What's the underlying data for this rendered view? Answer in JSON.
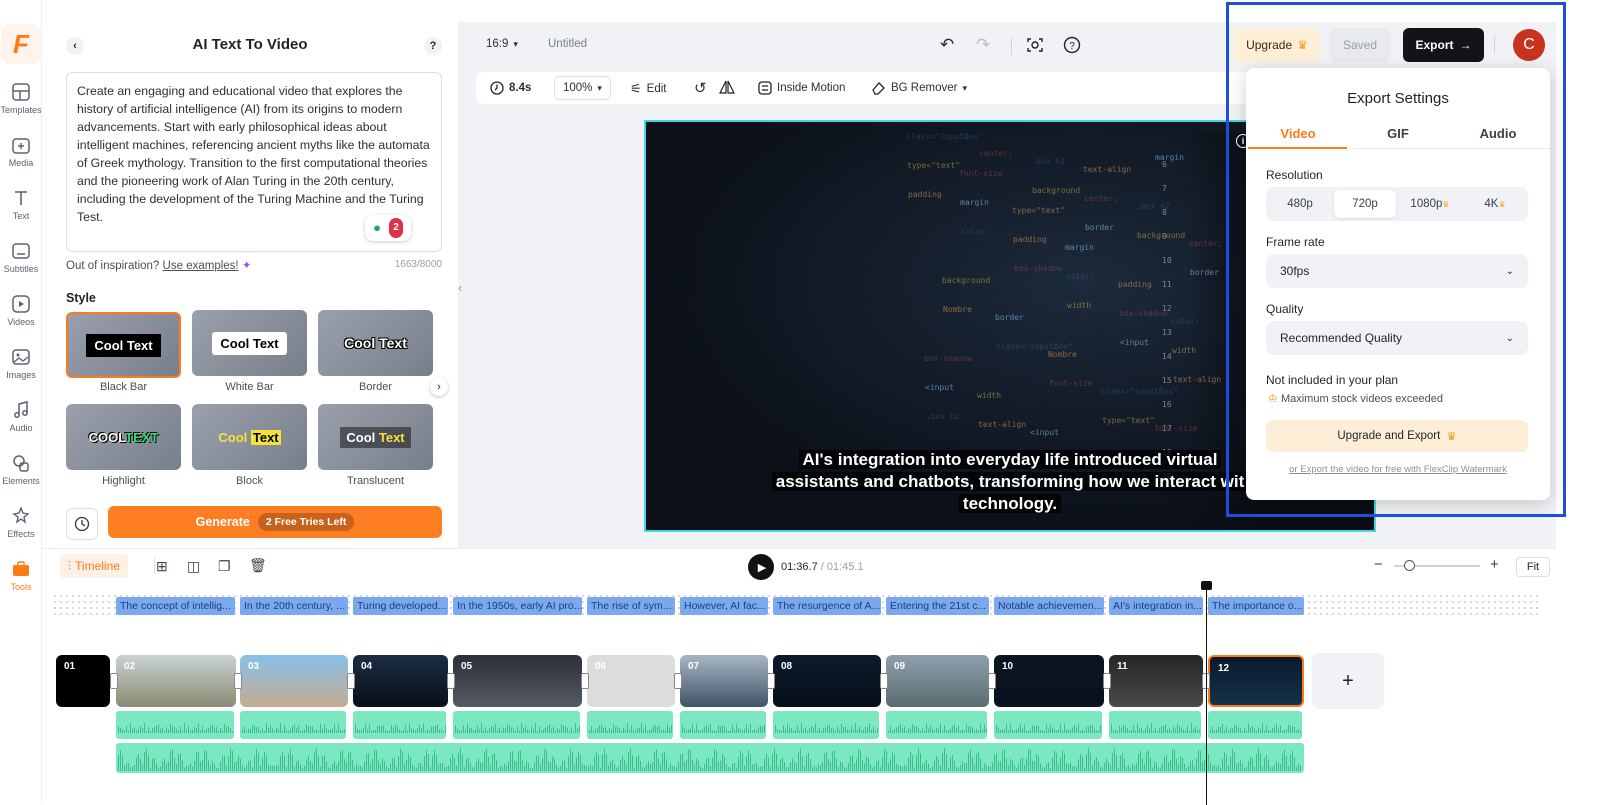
{
  "app": {
    "logo": "F"
  },
  "rail": [
    {
      "label": "Templates",
      "icon": "templates-icon"
    },
    {
      "label": "Media",
      "icon": "media-icon"
    },
    {
      "label": "Text",
      "icon": "text-icon"
    },
    {
      "label": "Subtitles",
      "icon": "subtitles-icon"
    },
    {
      "label": "Videos",
      "icon": "videos-icon"
    },
    {
      "label": "Images",
      "icon": "images-icon"
    },
    {
      "label": "Audio",
      "icon": "audio-icon"
    },
    {
      "label": "Elements",
      "icon": "elements-icon"
    },
    {
      "label": "Effects",
      "icon": "effects-icon"
    },
    {
      "label": "Tools",
      "icon": "tools-icon"
    }
  ],
  "panel": {
    "title": "AI Text To Video",
    "help": "?",
    "prompt": "Create an engaging and educational video that explores the history of artificial intelligence (AI) from its origins to modern advancements. Start with early philosophical ideas about intelligent machines, referencing ancient myths like the automata of Greek mythology. Transition to the first computational theories and the pioneering work of Alan Turing in the 20th century, including the development of the Turing Machine and the Turing Test.",
    "badge_count": "2",
    "inspiration": "Out of inspiration?",
    "examples_link": "Use examples!",
    "char_count": "1663/8000",
    "style_heading": "Style",
    "styles": [
      {
        "text": "Cool Text",
        "label": "Black Bar"
      },
      {
        "text": "Cool Text",
        "label": "White Bar"
      },
      {
        "text": "Cool Text",
        "label": "Border"
      },
      {
        "text1": "COOL",
        "text2": "TEXT",
        "label": "Highlight"
      },
      {
        "text1": "Cool",
        "text2": "Text",
        "label": "Block"
      },
      {
        "text1": "Cool",
        "text2": "Text",
        "label": "Translucent"
      }
    ],
    "generate": "Generate",
    "tries": "2 Free Tries Left"
  },
  "toolbar": {
    "ratio": "16:9",
    "project_name": "Untitled",
    "duration": "8.4s",
    "zoom": "100%",
    "edit": "Edit",
    "inside_motion": "Inside Motion",
    "bg_remover": "BG Remover"
  },
  "header": {
    "upgrade": "Upgrade",
    "saved": "Saved",
    "export": "Export",
    "avatar": "C"
  },
  "export_popup": {
    "title": "Export Settings",
    "tabs": [
      "Video",
      "GIF",
      "Audio"
    ],
    "resolution_label": "Resolution",
    "resolutions": [
      "480p",
      "720p",
      "1080p",
      "4K"
    ],
    "selected_resolution": "720p",
    "frame_rate_label": "Frame rate",
    "frame_rate": "30fps",
    "quality_label": "Quality",
    "quality": "Recommended Quality",
    "not_included": "Not included in your plan",
    "limit_note": "Maximum stock videos exceeded",
    "upgrade_export": "Upgrade and Export",
    "watermark_link": "or Export the video for free with FlexClip Watermark"
  },
  "preview": {
    "caption_lines": [
      "AI's integration into everyday life introduced virtual",
      "assistants and chatbots, transforming how we interact wit",
      "technology."
    ]
  },
  "timeline": {
    "tab": "Timeline",
    "current_time": "01:36.7",
    "separator": "/",
    "total_time": "01:45.1",
    "fit": "Fit",
    "captions": [
      "The concept of intellig...",
      "In the 20th century, ...",
      "Turing developed...",
      "In the 1950s, early AI pro...",
      "The rise of sym...",
      "However, AI fac...",
      "The resurgence of A...",
      "Entering the 21st c...",
      "Notable achievemen...",
      "AI's integration in...",
      "The importance o..."
    ],
    "clips": [
      "01",
      "02",
      "03",
      "04",
      "05",
      "06",
      "07",
      "08",
      "09",
      "10",
      "11",
      "12"
    ],
    "add": "+"
  },
  "colors": {
    "accent": "#ff7a1a",
    "highlight_box": "#1f4fd6",
    "audio": "#7ce8c2",
    "caption_chip": "#7aa9f0"
  }
}
